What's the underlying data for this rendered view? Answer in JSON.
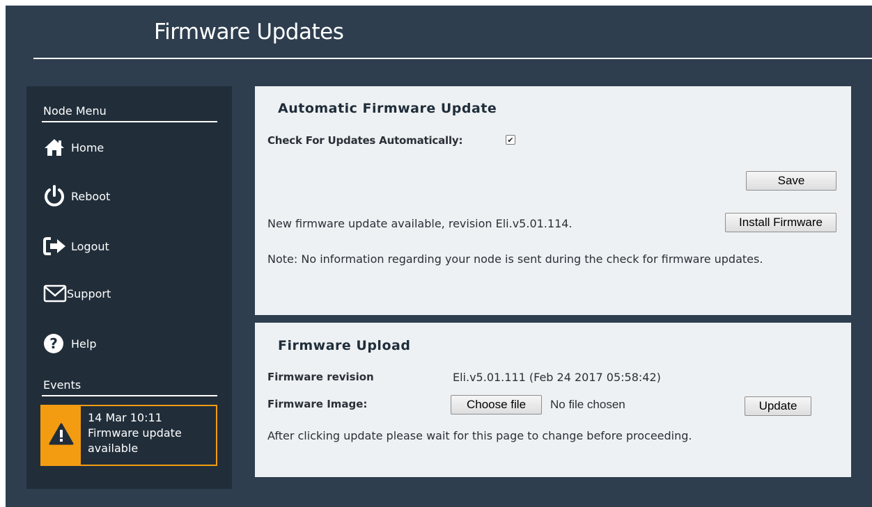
{
  "header": {
    "title": "Firmware Updates"
  },
  "sidebar": {
    "node_menu_heading": "Node Menu",
    "items": [
      {
        "label": "Home",
        "icon": "home-icon"
      },
      {
        "label": "Reboot",
        "icon": "power-icon"
      },
      {
        "label": "Logout",
        "icon": "logout-icon"
      },
      {
        "label": "Support",
        "icon": "envelope-icon"
      },
      {
        "label": "Help",
        "icon": "question-icon"
      }
    ],
    "events_heading": "Events",
    "event": {
      "icon": "warning-icon",
      "timestamp": "14 Mar 10:11",
      "message": "Firmware update available",
      "accent_color": "#f39c12"
    }
  },
  "auto_update": {
    "title": "Automatic Firmware Update",
    "check_label": "Check For Updates Automatically:",
    "check_checked": true,
    "save_label": "Save",
    "available_text": "New firmware update available, revision Eli.v5.01.114.",
    "install_label": "Install Firmware",
    "note": "Note: No information regarding your node is sent during the check for firmware updates."
  },
  "upload": {
    "title": "Firmware Upload",
    "revision_label": "Firmware revision",
    "revision_value": "Eli.v5.01.111 (Feb 24 2017 05:58:42)",
    "image_label": "Firmware Image:",
    "choose_label": "Choose file",
    "no_file_text": "No file chosen",
    "update_label": "Update",
    "wait_note": "After clicking update please wait for this page to change before proceeding."
  }
}
